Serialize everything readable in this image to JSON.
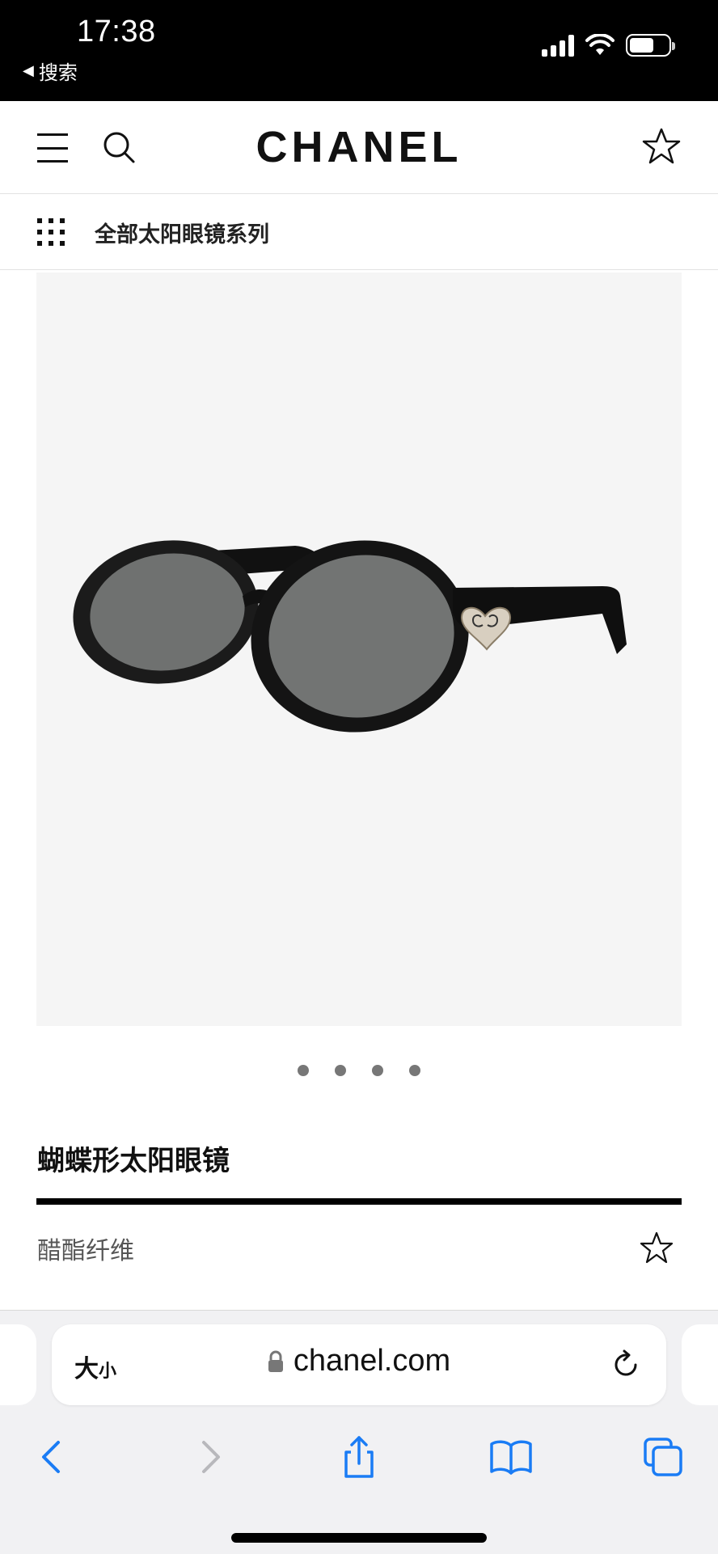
{
  "status_bar": {
    "time": "17:38",
    "back_app_label": "搜索",
    "battery_level": 0.62,
    "icons": [
      "signal-icon",
      "wifi-icon",
      "battery-icon"
    ]
  },
  "header": {
    "logo": "CHANEL",
    "icons": [
      "menu-icon",
      "search-icon",
      "star-icon"
    ]
  },
  "subnav": {
    "label": "全部太阳眼镜系列",
    "icon": "grid-icon"
  },
  "product": {
    "image_alt": "sunglasses",
    "image_count": 4,
    "current_image": 1,
    "title": "蝴蝶形太阳眼镜",
    "material": "醋酯纤维"
  },
  "browser": {
    "text_size_label_big": "大",
    "text_size_label_small": "小",
    "url": "chanel.com",
    "toolbar_icons": [
      "back-icon",
      "forward-icon",
      "share-icon",
      "bookmarks-icon",
      "tabs-icon"
    ]
  },
  "colors": {
    "accent_blue": "#1a7cf5",
    "disabled_gray": "#b8b8bc",
    "image_bg": "#f5f5f5"
  }
}
